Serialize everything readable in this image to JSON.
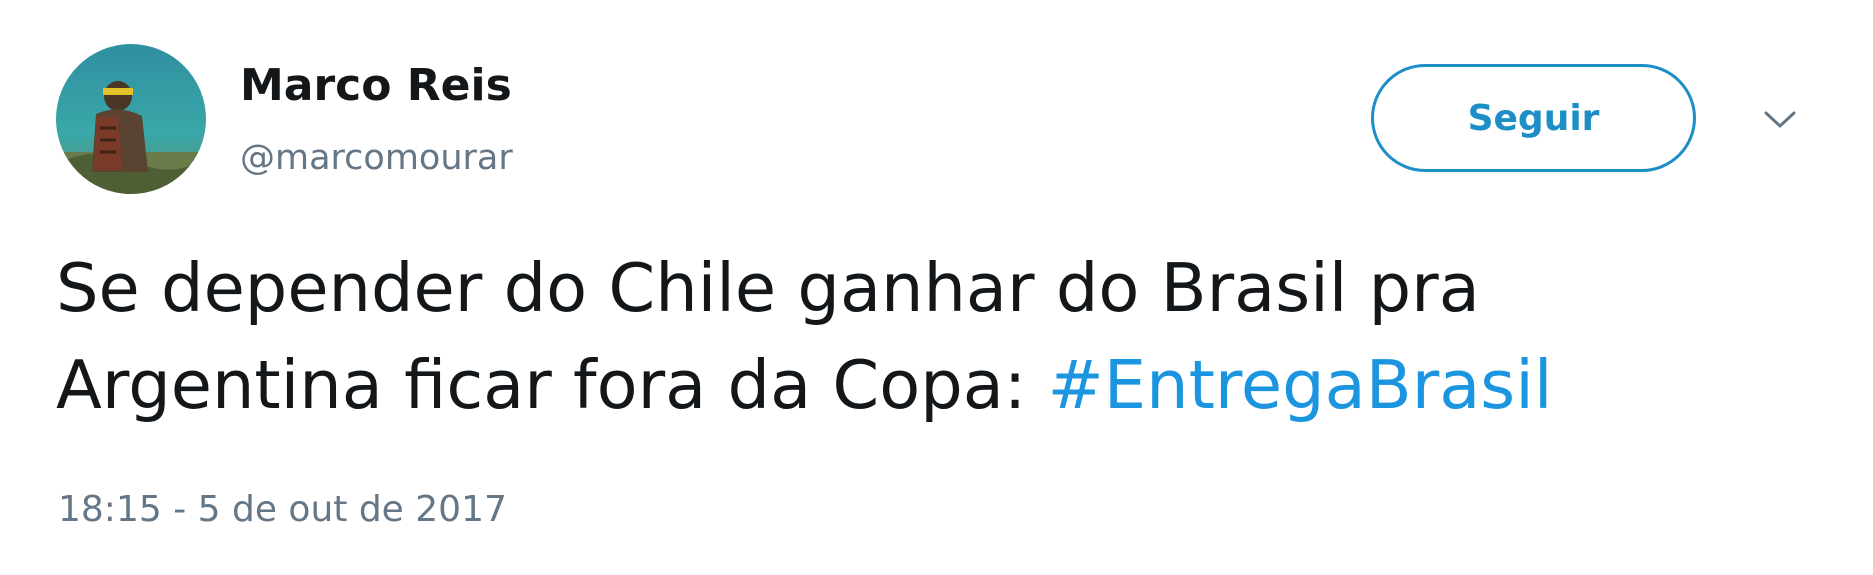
{
  "author": {
    "display_name": "Marco Reis",
    "handle": "@marcomourar",
    "avatar_icon": "profile-photo-person-backpack-sea"
  },
  "actions": {
    "follow_label": "Seguir",
    "more_icon": "chevron-down-icon"
  },
  "tweet": {
    "text_line1": "Se depender do Chile ganhar do Brasil pra",
    "text_line2": "Argentina ficar fora da Copa: ",
    "hashtag": "#EntregaBrasil",
    "timestamp": "18:15 - 5 de out de 2017"
  },
  "colors": {
    "accent": "#1b95e0",
    "button_border": "#1d8fc6",
    "text": "#14171a",
    "secondary_text": "#657786"
  }
}
